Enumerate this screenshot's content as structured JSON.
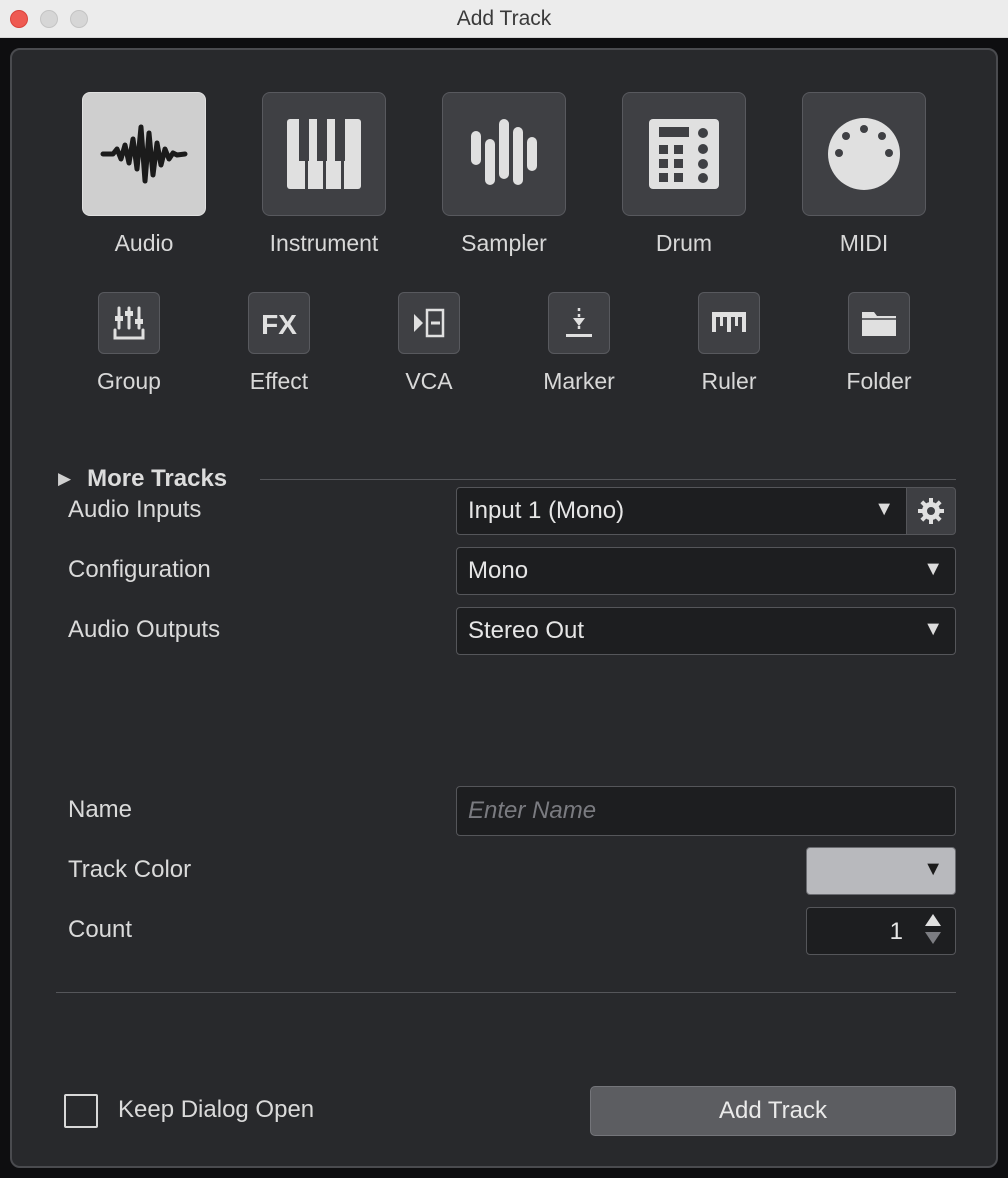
{
  "window": {
    "title": "Add Track"
  },
  "track_types_main": [
    {
      "label": "Audio",
      "icon": "waveform-icon",
      "selected": true
    },
    {
      "label": "Instrument",
      "icon": "piano-keys-icon",
      "selected": false
    },
    {
      "label": "Sampler",
      "icon": "sampler-bars-icon",
      "selected": false
    },
    {
      "label": "Drum",
      "icon": "drum-pads-icon",
      "selected": false
    },
    {
      "label": "MIDI",
      "icon": "midi-connector-icon",
      "selected": false
    }
  ],
  "track_types_secondary": [
    {
      "label": "Group",
      "icon": "group-faders-icon"
    },
    {
      "label": "Effect",
      "icon": "fx-icon"
    },
    {
      "label": "VCA",
      "icon": "vca-icon"
    },
    {
      "label": "Marker",
      "icon": "marker-icon"
    },
    {
      "label": "Ruler",
      "icon": "ruler-icon"
    },
    {
      "label": "Folder",
      "icon": "folder-icon"
    }
  ],
  "more_tracks": {
    "label": "More Tracks",
    "arrow": "▶"
  },
  "form": {
    "audio_inputs": {
      "label": "Audio Inputs",
      "value": "Input 1 (Mono)"
    },
    "configuration": {
      "label": "Configuration",
      "value": "Mono"
    },
    "audio_outputs": {
      "label": "Audio Outputs",
      "value": "Stereo Out"
    },
    "name": {
      "label": "Name",
      "value": "",
      "placeholder": "Enter Name"
    },
    "track_color": {
      "label": "Track Color",
      "color": "#b8b9bd"
    },
    "count": {
      "label": "Count",
      "value": "1"
    }
  },
  "footer": {
    "keep_open_label": "Keep Dialog Open",
    "keep_open_checked": false,
    "add_button_label": "Add Track"
  },
  "caret": "▼"
}
